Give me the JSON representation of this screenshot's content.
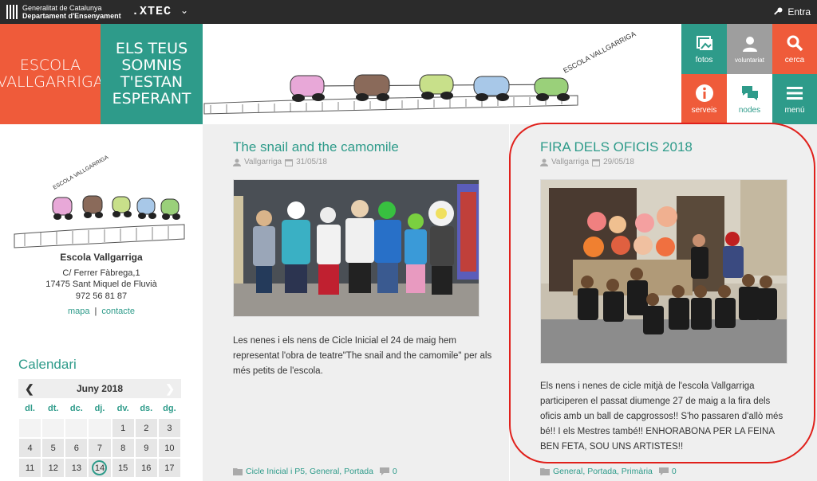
{
  "topbar": {
    "gencat_line1": "Generalitat de Catalunya",
    "gencat_line2": "Departament d'Ensenyament",
    "xtec": ".XTEC",
    "login": "Entra"
  },
  "header": {
    "school_tile": [
      "ESCOLA",
      "VALLGARRIGA"
    ],
    "motto_tile": [
      "ELS TEUS",
      "SOMNIS",
      "T'ESTAN",
      "ESPERANT"
    ],
    "banner_text": "ESCOLA VALLGARRIGA",
    "icons": [
      {
        "label": "fotos",
        "icon": "photo-icon",
        "color": "#2e9b8a"
      },
      {
        "label": "voluntariat",
        "icon": "user-icon",
        "color": "#9e9e9e"
      },
      {
        "label": "cerca",
        "icon": "search-icon",
        "color": "#ef5b3a"
      },
      {
        "label": "serveis",
        "icon": "info-icon",
        "color": "#ef5b3a"
      },
      {
        "label": "nodes",
        "icon": "chat-icon",
        "color": "#ffffff"
      },
      {
        "label": "menú",
        "icon": "menu-icon",
        "color": "#2e9b8a"
      }
    ]
  },
  "sidebar": {
    "logo_text": "ESCOLA VALLGARRIGA",
    "school_name": "Escola Vallgarriga",
    "address1": "C/ Ferrer Fàbrega,1",
    "address2": "17475 Sant Miquel de Fluvià",
    "phone": "972 56 81 87",
    "link_map": "mapa",
    "link_contact": "contacte",
    "calendar_title": "Calendari"
  },
  "calendar": {
    "month": "Juny 2018",
    "prev": "❮",
    "next": "❯",
    "dow": [
      "dl.",
      "dt.",
      "dc.",
      "dj.",
      "dv.",
      "ds.",
      "dg."
    ],
    "weeks": [
      [
        "",
        "",
        "",
        "",
        "1",
        "2",
        "3"
      ],
      [
        "4",
        "5",
        "6",
        "7",
        "8",
        "9",
        "10"
      ],
      [
        "11",
        "12",
        "13",
        "14",
        "15",
        "16",
        "17"
      ]
    ],
    "today": "14"
  },
  "posts": [
    {
      "title": "The snail and the camomile",
      "author": "Vallgarriga",
      "date": "31/05/18",
      "excerpt": "Les nenes i els nens de Cicle Inicial el 24 de maig hem representat l'obra de teatre\"The snail and the camomile\" per als més petits de l'escola.",
      "categories": "Cicle Inicial i P5, General, Portada",
      "comments": "0"
    },
    {
      "title": "FIRA DELS OFICIS 2018",
      "author": "Vallgarriga",
      "date": "29/05/18",
      "excerpt": "Els nens i nenes de cicle mitjà de l'escola Vallgarriga participeren el passat diumenge 27 de maig a la fira dels oficis amb un ball de capgrossos!! S'ho passaren d'allò més bé!! I els Mestres també!! ENHORABONA PER LA FEINA BEN FETA, SOU UNS ARTISTES!!",
      "categories": "General, Portada, Primària",
      "comments": "0"
    }
  ],
  "colors": {
    "teal": "#2e9b8a",
    "orange": "#ef5b3a",
    "dark": "#2b2b2b",
    "highlight": "#e0201b"
  }
}
